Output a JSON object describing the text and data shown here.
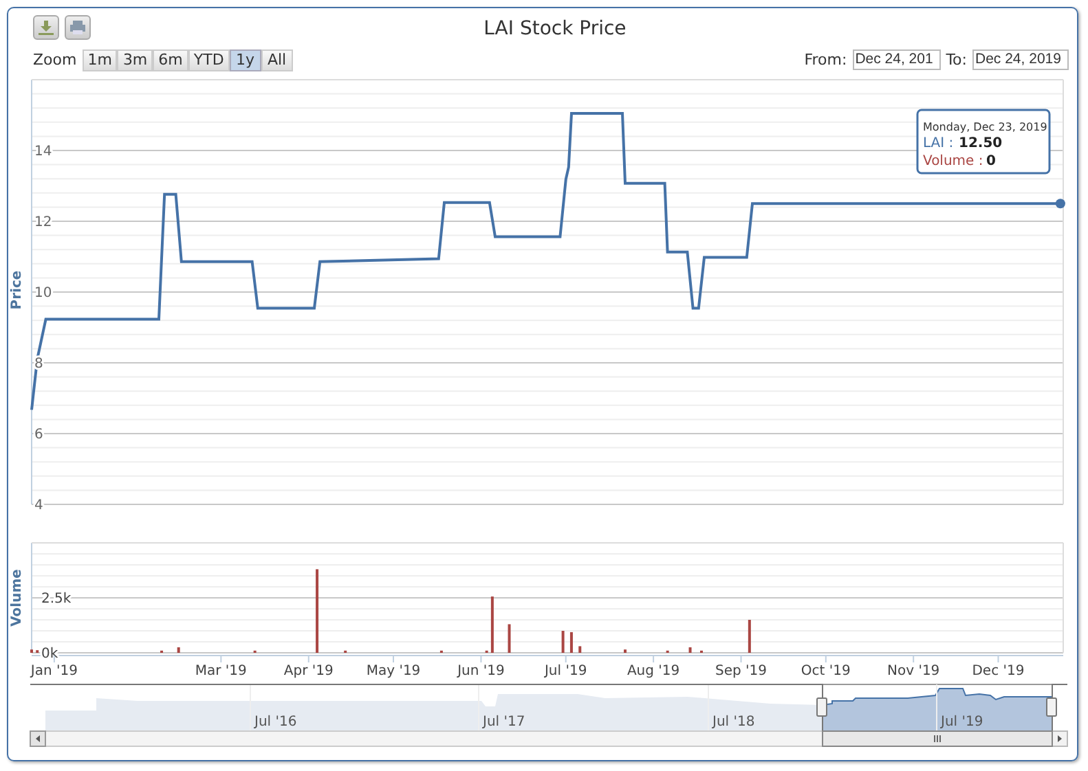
{
  "title": "LAI Stock Price",
  "toolbar": [
    {
      "kind": "download"
    },
    {
      "kind": "print"
    }
  ],
  "range_selector": {
    "label": "Zoom",
    "buttons": [
      {
        "label": "1m",
        "selected": false
      },
      {
        "label": "3m",
        "selected": false
      },
      {
        "label": "6m",
        "selected": false
      },
      {
        "label": "YTD",
        "selected": false
      },
      {
        "label": "1y",
        "selected": true
      },
      {
        "label": "All",
        "selected": false
      }
    ]
  },
  "date_range": {
    "from_label": "From:",
    "from_value": "Dec 24, 201",
    "to_label": "To:",
    "to_value": "Dec 24, 2019"
  },
  "price_chart": {
    "chart_data": {
      "type": "line",
      "grid": true,
      "ylabel": "Price",
      "xlim": [
        "2018-12-24",
        "2019-12-24"
      ],
      "ylim": [
        4,
        16
      ],
      "yticks": [
        4,
        6,
        8,
        10,
        12,
        14
      ],
      "x": [
        "2018-12-24",
        "2018-12-26",
        "2018-12-29",
        "2019-02-07",
        "2019-02-09",
        "2019-02-13",
        "2019-02-15",
        "2019-03-12",
        "2019-03-14",
        "2019-04-03",
        "2019-04-05",
        "2019-05-17",
        "2019-05-19",
        "2019-06-04",
        "2019-06-06",
        "2019-06-29",
        "2019-07-01",
        "2019-07-02",
        "2019-07-03",
        "2019-07-21",
        "2019-07-22",
        "2019-08-05",
        "2019-08-06",
        "2019-08-13",
        "2019-08-15",
        "2019-08-17",
        "2019-08-19",
        "2019-09-03",
        "2019-09-05",
        "2019-12-23"
      ],
      "series": [
        {
          "color": "#4572a7",
          "values": [
            6.67,
            8.11,
            9.23,
            9.23,
            12.76,
            12.76,
            10.86,
            10.86,
            9.54,
            9.54,
            10.86,
            10.94,
            12.53,
            12.53,
            11.56,
            11.56,
            13.19,
            13.53,
            15.05,
            15.05,
            13.07,
            13.07,
            11.13,
            11.13,
            9.54,
            9.54,
            10.98,
            10.98,
            12.5,
            12.5
          ]
        }
      ]
    }
  },
  "volume_chart": {
    "chart_data": {
      "type": "bar",
      "grid": true,
      "ylabel": "Volume",
      "xlim": [
        "2018-12-24",
        "2019-12-24"
      ],
      "ylim": [
        0,
        5000
      ],
      "yticks": [
        {
          "value": 0,
          "label": "0k"
        },
        {
          "value": 2500,
          "label": "2.5k"
        }
      ],
      "xticks": [
        {
          "value": "2019-01-01",
          "label": "Jan '19"
        },
        {
          "value": "2019-03-01",
          "label": "Mar '19"
        },
        {
          "value": "2019-04-01",
          "label": "Apr '19"
        },
        {
          "value": "2019-05-01",
          "label": "May '19"
        },
        {
          "value": "2019-06-01",
          "label": "Jun '19"
        },
        {
          "value": "2019-07-01",
          "label": "Jul '19"
        },
        {
          "value": "2019-08-01",
          "label": "Aug '19"
        },
        {
          "value": "2019-09-01",
          "label": "Sep '19"
        },
        {
          "value": "2019-10-01",
          "label": "Oct '19"
        },
        {
          "value": "2019-11-01",
          "label": "Nov '19"
        },
        {
          "value": "2019-12-01",
          "label": "Dec '19"
        }
      ],
      "x": [
        "2018-12-24",
        "2018-12-26",
        "2019-02-08",
        "2019-02-14",
        "2019-03-13",
        "2019-04-04",
        "2019-04-14",
        "2019-05-18",
        "2019-06-03",
        "2019-06-05",
        "2019-06-11",
        "2019-06-30",
        "2019-07-03",
        "2019-07-06",
        "2019-07-22",
        "2019-08-06",
        "2019-08-14",
        "2019-08-18",
        "2019-09-04"
      ],
      "series": [
        {
          "color": "#aa4643",
          "values": [
            150,
            120,
            100,
            250,
            100,
            3800,
            100,
            100,
            100,
            2560,
            1300,
            1000,
            940,
            300,
            150,
            100,
            250,
            100,
            1500
          ]
        }
      ]
    }
  },
  "tooltip": {
    "date": "Monday, Dec 23, 2019",
    "series_label": "LAI :",
    "series_value": "12.50",
    "volume_label": "Volume :",
    "volume_value": "0"
  },
  "navigator": {
    "labels": [
      "Jul '16",
      "Jul '17",
      "Jul '18",
      "Jul '19"
    ]
  }
}
